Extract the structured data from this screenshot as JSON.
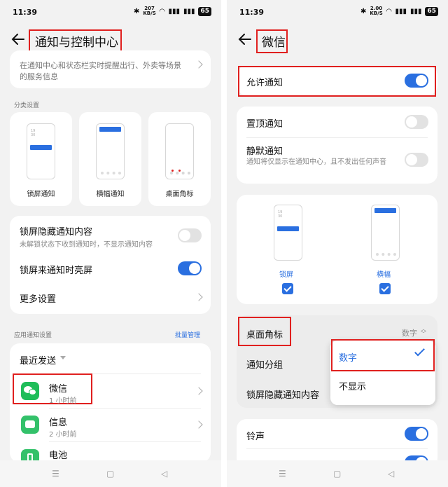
{
  "status_left": {
    "time": "11:39",
    "speed_top": "207",
    "speed_unit": "KB/S",
    "battery": "65"
  },
  "status_right": {
    "time": "11:39",
    "speed_top": "2.00",
    "speed_unit": "KB/S",
    "battery": "65"
  },
  "left": {
    "title": "通知与控制中心",
    "top_desc": "在通知中心和状态栏实时提醒出行、外卖等场景的服务信息",
    "category_header": "分类设置",
    "categories": [
      {
        "label": "锁屏通知"
      },
      {
        "label": "横幅通知"
      },
      {
        "label": "桌面角标"
      }
    ],
    "phone_clock": "19\n30",
    "hide_content_label": "锁屏隐藏通知内容",
    "hide_content_desc": "未解锁状态下收到通知时，不显示通知内容",
    "wake_label": "锁屏来通知时亮屏",
    "more_label": "更多设置",
    "app_header": "应用通知设置",
    "batch_manage": "批量管理",
    "sort_label": "最近发送",
    "apps": [
      {
        "name": "微信",
        "time": "1 小时前"
      },
      {
        "name": "信息",
        "time": "2 小时前"
      },
      {
        "name": "电池",
        "time": ""
      }
    ]
  },
  "right": {
    "title": "微信",
    "allow_label": "允许通知",
    "pin_label": "置顶通知",
    "silent_label": "静默通知",
    "silent_desc": "通知将仅显示在通知中心，且不发出任何声音",
    "phone_clock": "19\n30",
    "styles": [
      {
        "label": "锁屏"
      },
      {
        "label": "横幅"
      }
    ],
    "badge_label": "桌面角标",
    "badge_value": "数字",
    "group_label": "通知分组",
    "hide_content_label": "锁屏隐藏通知内容",
    "popup_options": [
      {
        "label": "数字"
      },
      {
        "label": "不显示"
      }
    ],
    "ringtone_label": "铃声"
  },
  "colors": {
    "accent": "#2a6fe0",
    "highlight": "#e0201f",
    "wechat": "#1fbd59",
    "messages": "#33c16a"
  }
}
